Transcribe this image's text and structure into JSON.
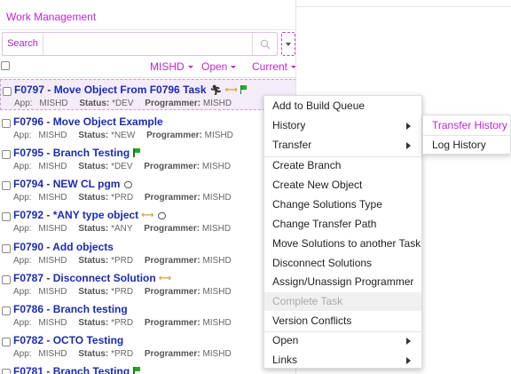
{
  "panel": {
    "title": "Work Management"
  },
  "search": {
    "label": "Search",
    "placeholder": "",
    "value": ""
  },
  "filters": {
    "owner": "MISHD",
    "state": "Open",
    "scope": "Current"
  },
  "meta_labels": {
    "app": "App:",
    "status": "Status:",
    "programmer": "Programmer:"
  },
  "tasks": [
    {
      "title": "F0797 - Move Object From F0796 Task",
      "app": "MISHD",
      "status": "*DEV",
      "programmer": "MISHD"
    },
    {
      "title": "F0796 - Move Object Example",
      "app": "MISHD",
      "status": "*NEW",
      "programmer": "MISHD"
    },
    {
      "title": "F0795 - Branch Testing",
      "app": "MISHD",
      "status": "*DEV",
      "programmer": "MISHD"
    },
    {
      "title": "F0794 - NEW CL pgm",
      "app": "MISHD",
      "status": "*PRD",
      "programmer": "MISHD"
    },
    {
      "title": "F0792 - *ANY type object",
      "app": "MISHD",
      "status": "*ANY",
      "programmer": "MISHD"
    },
    {
      "title": "F0790 - Add objects",
      "app": "MISHD",
      "status": "*PRD",
      "programmer": "MISHD"
    },
    {
      "title": "F0787 - Disconnect Solution",
      "app": "MISHD",
      "status": "*PRD",
      "programmer": "MISHD"
    },
    {
      "title": "F0786 - Branch testing",
      "app": "MISHD",
      "status": "*PRD",
      "programmer": "MISHD"
    },
    {
      "title": "F0782 - OCTO Testing",
      "app": "MISHD",
      "status": "*PRD",
      "programmer": "MISHD"
    },
    {
      "title": "F0781 - Branch Testing",
      "app": "",
      "status": "",
      "programmer": ""
    }
  ],
  "context_menu": {
    "add_to_build_queue": "Add to Build Queue",
    "history": "History",
    "transfer": "Transfer",
    "create_branch": "Create Branch",
    "create_new_object": "Create New Object",
    "change_solutions_type": "Change Solutions Type",
    "change_transfer_path": "Change Transfer Path",
    "move_solutions": "Move Solutions to another Task",
    "disconnect_solutions": "Disconnect Solutions",
    "assign_programmer": "Assign/Unassign Programmer",
    "complete_task": "Complete Task",
    "version_conflicts": "Version Conflicts",
    "open": "Open",
    "links": "Links"
  },
  "history_submenu": {
    "transfer_history": "Transfer History",
    "log_history": "Log History"
  },
  "colors": {
    "accent": "#c026d3",
    "task_title": "#1b2bb5",
    "flag": "#22aa22",
    "link": "#e0a020"
  },
  "icons": {
    "search": "search-icon",
    "flag": "flag-icon",
    "link": "link-icon",
    "comment": "comment-icon",
    "runner": "running-icon"
  }
}
